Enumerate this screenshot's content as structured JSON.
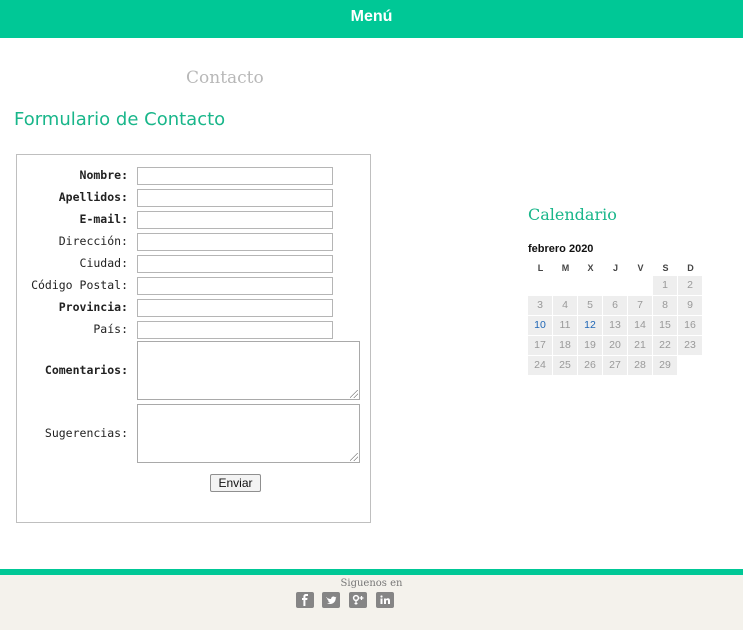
{
  "header": {
    "menu_label": "Menú"
  },
  "page": {
    "heading": "Contacto"
  },
  "form": {
    "title": "Formulario de Contacto",
    "labels": {
      "nombre": "Nombre:",
      "apellidos": "Apellidos:",
      "email": "E-mail:",
      "direccion": "Dirección:",
      "ciudad": "Ciudad:",
      "codigo_postal": "Código Postal:",
      "provincia": "Provincia:",
      "pais": "País:",
      "comentarios": "Comentarios:",
      "sugerencias": "Sugerencias:"
    },
    "values": {
      "nombre": "",
      "apellidos": "",
      "email": "",
      "direccion": "",
      "ciudad": "",
      "codigo_postal": "",
      "provincia": "",
      "pais": "",
      "comentarios": "",
      "sugerencias": ""
    },
    "submit_label": "Enviar"
  },
  "calendar": {
    "title": "Calendario",
    "month": "febrero 2020",
    "weekdays": [
      "L",
      "M",
      "X",
      "J",
      "V",
      "S",
      "D"
    ],
    "weeks": [
      [
        "",
        "",
        "",
        "",
        "",
        "1",
        "2"
      ],
      [
        "3",
        "4",
        "5",
        "6",
        "7",
        "8",
        "9"
      ],
      [
        "10",
        "11",
        "12",
        "13",
        "14",
        "15",
        "16"
      ],
      [
        "17",
        "18",
        "19",
        "20",
        "21",
        "22",
        "23"
      ],
      [
        "24",
        "25",
        "26",
        "27",
        "28",
        "29",
        ""
      ]
    ],
    "linked_days": [
      "12",
      "10"
    ],
    "link_color": "#1f66b5"
  },
  "footer": {
    "follow_text": "Siguenos en",
    "social_icons": [
      "facebook-icon",
      "twitter-icon",
      "google-plus-icon",
      "linkedin-icon"
    ]
  },
  "colors": {
    "accent": "#00c896",
    "title_green": "#19b68a",
    "footer_bg": "#f4f2ec"
  }
}
